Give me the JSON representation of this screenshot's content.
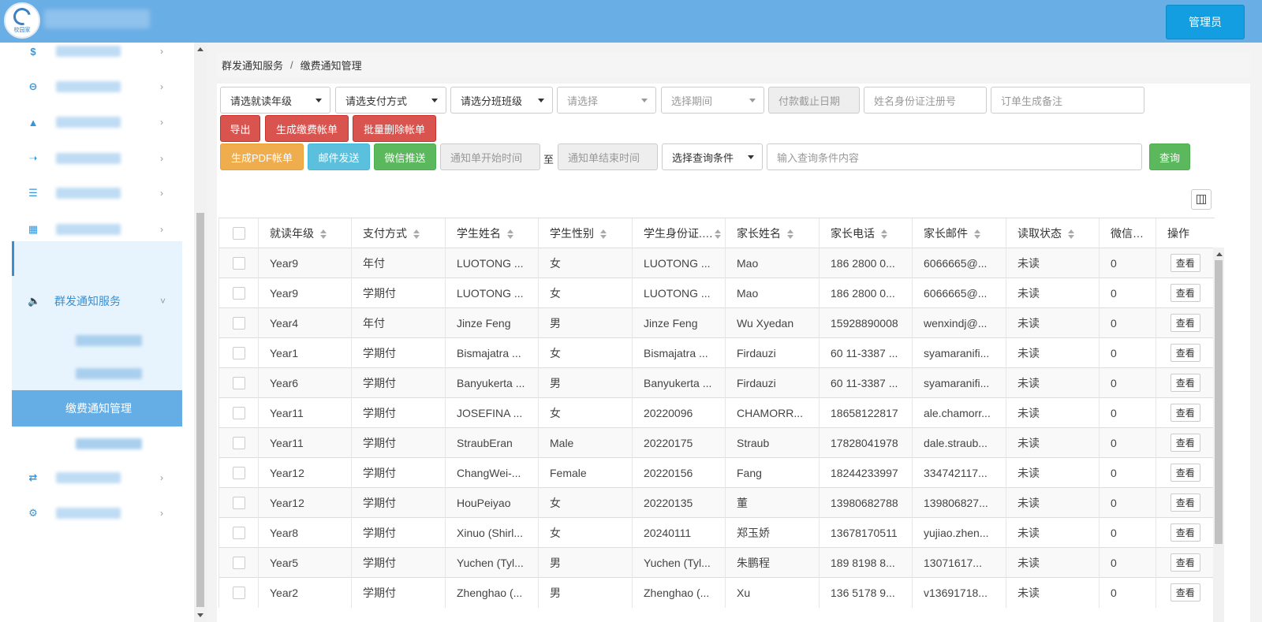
{
  "header": {
    "logo_text": "校园家",
    "admin_label": "管理员"
  },
  "sidebar": {
    "items": [
      {
        "icon": "$",
        "icon_name": "dollar-icon"
      },
      {
        "icon": "⊖",
        "icon_name": "minus-circle-icon"
      },
      {
        "icon": "▲",
        "icon_name": "upload-icon"
      },
      {
        "icon": "➝",
        "icon_name": "share-icon"
      },
      {
        "icon": "☰",
        "icon_name": "list-icon"
      },
      {
        "icon": "▦",
        "icon_name": "chart-area-icon"
      },
      {
        "icon": "▮",
        "icon_name": "bar-chart-icon"
      }
    ],
    "active_group": {
      "icon_name": "volume-icon",
      "label": "群发通知服务"
    },
    "active_sub": "缴费通知管理",
    "bottom_items": [
      {
        "icon": "⇄",
        "icon_name": "refresh-icon"
      },
      {
        "icon": "⚙",
        "icon_name": "gear-icon"
      }
    ]
  },
  "breadcrumb": {
    "parent": "群发通知服务",
    "separator": "/",
    "current": "缴费通知管理"
  },
  "filters": {
    "grade": "请选就读年级",
    "payment": "请选支付方式",
    "class": "请选分班班级",
    "select": "请选择",
    "period": "选择期间",
    "due_date": "付款截止日期",
    "name_placeholder": "姓名身份证注册号",
    "remark_placeholder": "订单生成备注",
    "start_time": "通知单开始时间",
    "to": "至",
    "end_time": "通知单结束时间",
    "query_condition": "选择查询条件",
    "query_placeholder": "输入查询条件内容"
  },
  "buttons": {
    "export": "导出",
    "generate_bill": "生成缴费帐单",
    "batch_delete": "批量删除帐单",
    "generate_pdf": "生成PDF帐单",
    "email_send": "邮件发送",
    "wechat_push": "微信推送",
    "query": "查询"
  },
  "colors": {
    "header": "#6aaee6",
    "admin": "#129ee0",
    "sidebar_active": "#65aee5",
    "danger": "#d9534f",
    "warning": "#f0ad4e",
    "info": "#5bc0de",
    "success": "#5cb85c"
  },
  "table": {
    "columns": [
      "就读年级",
      "支付方式",
      "学生姓名",
      "学生性别",
      "学生身份证...",
      "家长姓名",
      "家长电话",
      "家长邮件",
      "读取状态",
      "微信推送",
      "操作"
    ],
    "view_label": "查看",
    "rows": [
      [
        "Year9",
        "年付",
        "LUOTONG ...",
        "女",
        "LUOTONG ...",
        "Mao",
        "186 2800 0...",
        "6066665@...",
        "未读",
        "0"
      ],
      [
        "Year9",
        "学期付",
        "LUOTONG ...",
        "女",
        "LUOTONG ...",
        "Mao",
        "186 2800 0...",
        "6066665@...",
        "未读",
        "0"
      ],
      [
        "Year4",
        "年付",
        "Jinze Feng",
        "男",
        "Jinze Feng",
        "Wu Xyedan",
        "15928890008",
        "wenxindj@...",
        "未读",
        "0"
      ],
      [
        "Year1",
        "学期付",
        "Bismajatra ...",
        "女",
        "Bismajatra ...",
        "Firdauzi",
        "60 11-3387 ...",
        "syamaranifi...",
        "未读",
        "0"
      ],
      [
        "Year6",
        "学期付",
        "Banyukerta ...",
        "男",
        "Banyukerta ...",
        "Firdauzi",
        "60 11-3387 ...",
        "syamaranifi...",
        "未读",
        "0"
      ],
      [
        "Year11",
        "学期付",
        "JOSEFINA ...",
        "女",
        "20220096",
        "CHAMORR...",
        "18658122817",
        "ale.chamorr...",
        "未读",
        "0"
      ],
      [
        "Year11",
        "学期付",
        "StraubEran",
        "Male",
        "20220175",
        "Straub",
        "17828041978",
        "dale.straub...",
        "未读",
        "0"
      ],
      [
        "Year12",
        "学期付",
        "ChangWei-...",
        "Female",
        "20220156",
        "Fang",
        "18244233997",
        "334742117...",
        "未读",
        "0"
      ],
      [
        "Year12",
        "学期付",
        "HouPeiyao",
        "女",
        "20220135",
        "董",
        "13980682788",
        "139806827...",
        "未读",
        "0"
      ],
      [
        "Year8",
        "学期付",
        "Xinuo (Shirl...",
        "女",
        "20240111",
        "郑玉娇",
        "13678170511",
        "yujiao.zhen...",
        "未读",
        "0"
      ],
      [
        "Year5",
        "学期付",
        "Yuchen (Tyl...",
        "男",
        "Yuchen (Tyl...",
        "朱鹏程",
        "189 8198 8...",
        "13071617...",
        "未读",
        "0"
      ],
      [
        "Year2",
        "学期付",
        "Zhenghao (...",
        "男",
        "Zhenghao (...",
        "Xu",
        "136 5178 9...",
        "v13691718...",
        "未读",
        "0"
      ]
    ]
  }
}
